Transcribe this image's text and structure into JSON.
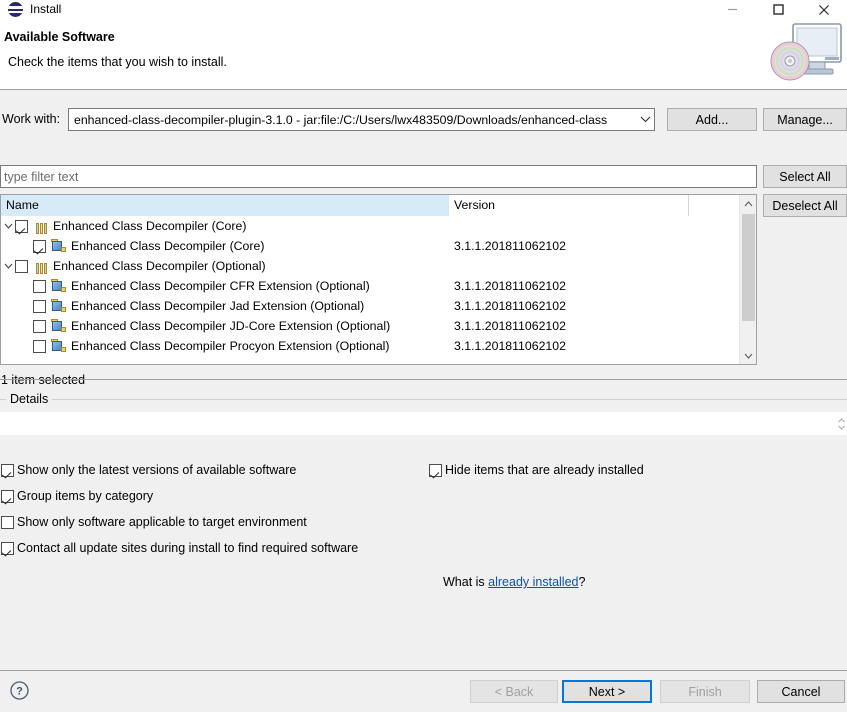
{
  "window": {
    "title": "Install",
    "icon": "eclipse-icon",
    "controls": [
      {
        "name": "minimize-button",
        "glyph": "minimize-icon"
      },
      {
        "name": "maximize-button",
        "glyph": "maximize-icon"
      },
      {
        "name": "close-button",
        "glyph": "close-icon"
      }
    ]
  },
  "header": {
    "title": "Available Software",
    "subtitle": "Check the items that you wish to install.",
    "banner_icon": "install-cd-monitor-icon"
  },
  "work_with": {
    "label": "Work with:",
    "value": "enhanced-class-decompiler-plugin-3.1.0 - jar:file:/C:/Users/lwx483509/Downloads/enhanced-class",
    "dropdown_icon": "chevron-down-icon",
    "add_label": "Add...",
    "manage_label": "Manage..."
  },
  "filter": {
    "placeholder": "type filter text",
    "value": ""
  },
  "selection_buttons": {
    "select_all": "Select All",
    "deselect_all": "Deselect All"
  },
  "table": {
    "columns": [
      "Name",
      "Version"
    ],
    "rows": [
      {
        "name": "Enhanced Class Decompiler (Core)",
        "version": "",
        "level": 0,
        "checked": true,
        "expanded": true,
        "icon": "category-icon"
      },
      {
        "name": "Enhanced Class Decompiler (Core)",
        "version": "3.1.1.201811062102",
        "level": 1,
        "checked": true,
        "expanded": null,
        "icon": "feature-package-icon"
      },
      {
        "name": "Enhanced Class Decompiler (Optional)",
        "version": "",
        "level": 0,
        "checked": false,
        "expanded": true,
        "icon": "category-icon"
      },
      {
        "name": "Enhanced Class Decompiler CFR Extension (Optional)",
        "version": "3.1.1.201811062102",
        "level": 1,
        "checked": false,
        "expanded": null,
        "icon": "feature-package-icon"
      },
      {
        "name": "Enhanced Class Decompiler Jad Extension (Optional)",
        "version": "3.1.1.201811062102",
        "level": 1,
        "checked": false,
        "expanded": null,
        "icon": "feature-package-icon"
      },
      {
        "name": "Enhanced Class Decompiler JD-Core Extension (Optional)",
        "version": "3.1.1.201811062102",
        "level": 1,
        "checked": false,
        "expanded": null,
        "icon": "feature-package-icon"
      },
      {
        "name": "Enhanced Class Decompiler Procyon Extension (Optional)",
        "version": "3.1.1.201811062102",
        "level": 1,
        "checked": false,
        "expanded": null,
        "icon": "feature-package-icon"
      }
    ],
    "scrollbar": {
      "up_icon": "chevron-up-icon",
      "down_icon": "chevron-down-icon"
    }
  },
  "status": {
    "selected_text": "1 item selected"
  },
  "details": {
    "group_label": "Details",
    "value": ""
  },
  "options": {
    "left": [
      {
        "label": "Show only the latest versions of available software",
        "checked": true,
        "name": "option-latest-versions"
      },
      {
        "label": "Group items by category",
        "checked": true,
        "name": "option-group-by-category"
      },
      {
        "label": "Show only software applicable to target environment",
        "checked": false,
        "name": "option-applicable-target"
      },
      {
        "label": "Contact all update sites during install to find required software",
        "checked": true,
        "name": "option-contact-update-sites"
      }
    ],
    "right": [
      {
        "label": "Hide items that are already installed",
        "checked": true,
        "name": "option-hide-installed"
      }
    ],
    "what_is_prefix": "What is ",
    "what_is_link": "already installed",
    "what_is_suffix": "?"
  },
  "footer": {
    "help_icon": "help-question-icon",
    "buttons": [
      {
        "label": "< Back",
        "name": "back-button",
        "disabled": true
      },
      {
        "label": "Next >",
        "name": "next-button",
        "disabled": false,
        "default": true
      },
      {
        "label": "Finish",
        "name": "finish-button",
        "disabled": true
      },
      {
        "label": "Cancel",
        "name": "cancel-button",
        "disabled": false
      }
    ]
  },
  "colors": {
    "dialog_bg": "#f0f0f0",
    "accent_focus": "#0078d7",
    "link": "#0b53a6",
    "header_highlight": "#d6ebf7"
  }
}
